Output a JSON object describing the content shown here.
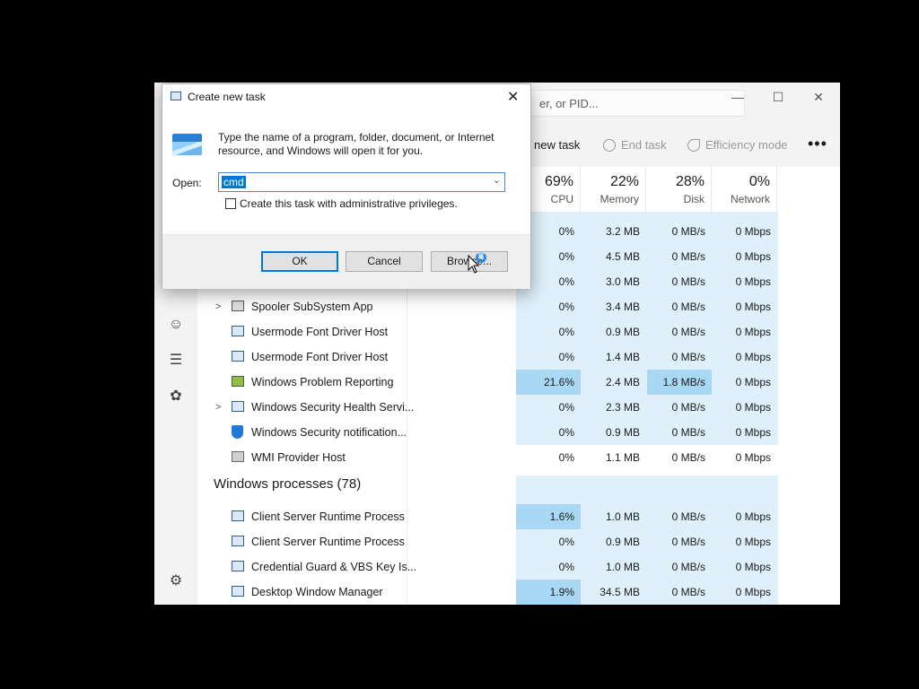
{
  "window": {
    "search_placeholder": "er, or PID...",
    "controls": {
      "minimize": "—",
      "maximize": "☐",
      "close": "✕"
    }
  },
  "commands": {
    "run_new_task": "new task",
    "end_task": "End task",
    "efficiency_mode": "Efficiency mode",
    "more": "•••"
  },
  "columns": [
    {
      "pct": "69%",
      "label": "CPU"
    },
    {
      "pct": "22%",
      "label": "Memory"
    },
    {
      "pct": "28%",
      "label": "Disk"
    },
    {
      "pct": "0%",
      "label": "Network"
    }
  ],
  "rows_top": [
    {
      "cpu": "0%",
      "mem": "3.2 MB",
      "disk": "0 MB/s",
      "net": "0 Mbps"
    },
    {
      "cpu": "0%",
      "mem": "4.5 MB",
      "disk": "0 MB/s",
      "net": "0 Mbps"
    },
    {
      "cpu": "0%",
      "mem": "3.0 MB",
      "disk": "0 MB/s",
      "net": "0 Mbps"
    }
  ],
  "processes": [
    {
      "name": "Spooler SubSystem App",
      "expand": ">",
      "cpu": "0%",
      "mem": "3.4 MB",
      "disk": "0 MB/s",
      "net": "0 Mbps"
    },
    {
      "name": "Usermode Font Driver Host",
      "expand": "",
      "cpu": "0%",
      "mem": "0.9 MB",
      "disk": "0 MB/s",
      "net": "0 Mbps"
    },
    {
      "name": "Usermode Font Driver Host",
      "expand": "",
      "cpu": "0%",
      "mem": "1.4 MB",
      "disk": "0 MB/s",
      "net": "0 Mbps"
    },
    {
      "name": "Windows Problem Reporting",
      "expand": "",
      "cpu": "21.6%",
      "mem": "2.4 MB",
      "disk": "1.8 MB/s",
      "net": "0 Mbps"
    },
    {
      "name": "Windows Security Health Servi...",
      "expand": ">",
      "cpu": "0%",
      "mem": "2.3 MB",
      "disk": "0 MB/s",
      "net": "0 Mbps"
    },
    {
      "name": "Windows Security notification...",
      "expand": "",
      "cpu": "0%",
      "mem": "0.9 MB",
      "disk": "0 MB/s",
      "net": "0 Mbps"
    },
    {
      "name": "WMI Provider Host",
      "expand": "",
      "cpu": "0%",
      "mem": "1.1 MB",
      "disk": "0 MB/s",
      "net": "0 Mbps"
    }
  ],
  "group_windows": "Windows processes (78)",
  "windows_processes": [
    {
      "name": "Client Server Runtime Process",
      "cpu": "1.6%",
      "mem": "1.0 MB",
      "disk": "0 MB/s",
      "net": "0 Mbps"
    },
    {
      "name": "Client Server Runtime Process",
      "cpu": "0%",
      "mem": "0.9 MB",
      "disk": "0 MB/s",
      "net": "0 Mbps"
    },
    {
      "name": "Credential Guard & VBS Key Is...",
      "cpu": "0%",
      "mem": "1.0 MB",
      "disk": "0 MB/s",
      "net": "0 Mbps"
    },
    {
      "name": "Desktop Window Manager",
      "cpu": "1.9%",
      "mem": "34.5 MB",
      "disk": "0 MB/s",
      "net": "0 Mbps"
    }
  ],
  "dialog": {
    "title": "Create new task",
    "close": "✕",
    "message": "Type the name of a program, folder, document, or Internet resource, and Windows will open it for you.",
    "open_label": "Open:",
    "open_value": "cmd",
    "admin_checkbox": "Create this task with administrative privileges.",
    "ok": "OK",
    "cancel": "Cancel",
    "browse": "Browse..."
  }
}
